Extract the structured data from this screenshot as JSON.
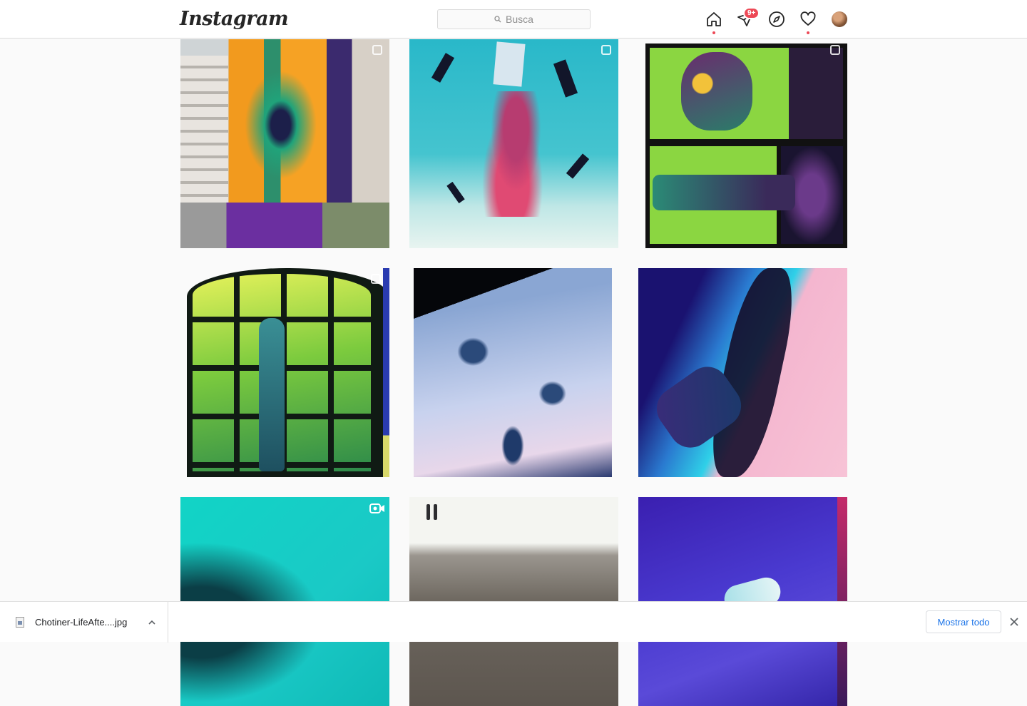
{
  "header": {
    "logo_text": "Instagram",
    "search_placeholder": "Busca",
    "notifications_badge": "9+"
  },
  "grid": {
    "posts": [
      {
        "type": "carousel"
      },
      {
        "type": "carousel"
      },
      {
        "type": "carousel"
      },
      {
        "type": "carousel"
      },
      {
        "type": "single"
      },
      {
        "type": "single"
      },
      {
        "type": "video"
      },
      {
        "type": "single"
      },
      {
        "type": "single"
      }
    ]
  },
  "download_bar": {
    "file_name": "Chotiner-LifeAfte....jpg",
    "show_all_label": "Mostrar todo"
  },
  "colors": {
    "accent_red": "#ed4956",
    "link_blue": "#1a73e8"
  }
}
